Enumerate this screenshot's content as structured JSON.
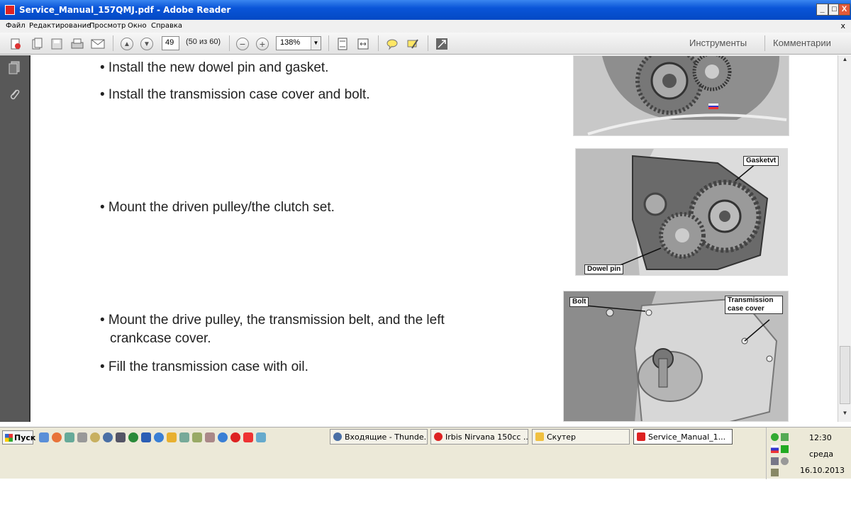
{
  "window": {
    "title": "Service_Manual_157QMJ.pdf - Adobe Reader",
    "min_label": "_",
    "max_label": "□",
    "close_label": "X"
  },
  "menu": {
    "items": [
      "Файл",
      "Редактирование",
      "Просмотр",
      "Окно",
      "Справка"
    ],
    "close_label": "x"
  },
  "toolbar": {
    "page_number": "49",
    "page_count": "(50 из 60)",
    "zoom": "138%",
    "tools_label": "Инструменты",
    "comments_label": "Комментарии"
  },
  "document": {
    "bullets": [
      "• Install the new dowel pin and gasket.",
      "• Install the transmission case cover and bolt.",
      "• Mount the driven pulley/the clutch set.",
      "• Mount the drive pulley, the transmission belt, and the left",
      "crankcase cover.",
      "• Fill the transmission case with oil."
    ],
    "photo_labels": {
      "gasket": "Gasketvt",
      "dowel": "Dowel pin",
      "bolt": "Bolt",
      "cover_line1": "Transmission",
      "cover_line2": "case cover"
    }
  },
  "taskbar": {
    "start_label": "Пуск",
    "tasks": [
      "Входящие - Thunde...",
      "Irbis Nirvana 150cc ...",
      "Скутер",
      "Service_Manual_1..."
    ],
    "clock": "12:30",
    "day": "среда",
    "date": "16.10.2013"
  }
}
